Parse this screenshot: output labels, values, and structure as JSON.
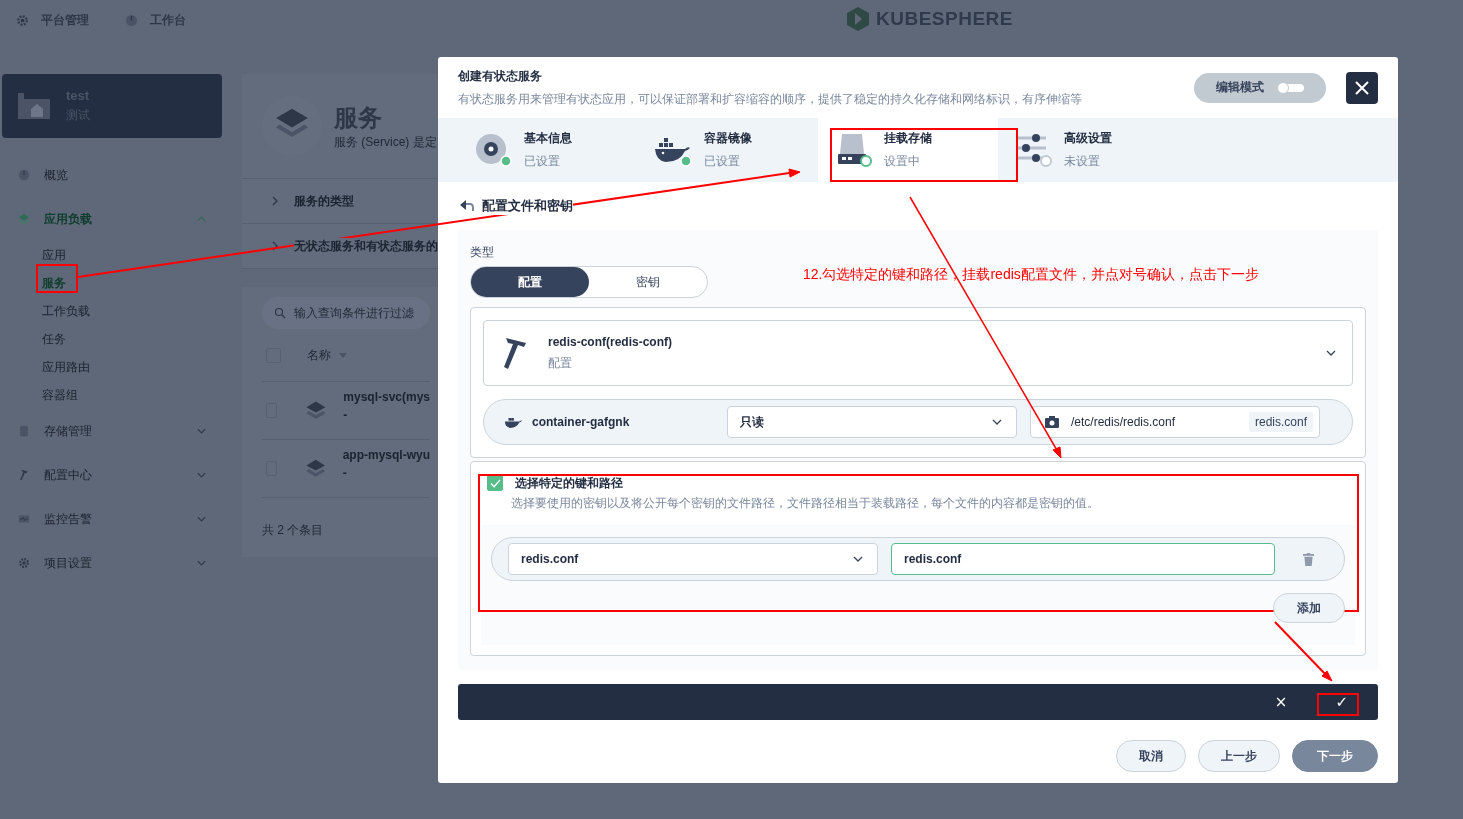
{
  "top_nav": [
    {
      "label": "平台管理"
    },
    {
      "label": "工作台"
    }
  ],
  "logo": {
    "text": "KUBESPHERE"
  },
  "project": {
    "name": "test",
    "alias": "测试"
  },
  "sidebar": {
    "items": [
      {
        "label": "概览",
        "selected": false
      },
      {
        "label": "应用负载",
        "selected": true,
        "expanded": true,
        "children": [
          {
            "label": "应用",
            "selected": false
          },
          {
            "label": "服务",
            "selected": true
          },
          {
            "label": "工作负载",
            "selected": false
          },
          {
            "label": "任务",
            "selected": false
          },
          {
            "label": "应用路由",
            "selected": false
          },
          {
            "label": "容器组",
            "selected": false
          }
        ]
      },
      {
        "label": "存储管理",
        "selected": false,
        "expanded": false
      },
      {
        "label": "配置中心",
        "selected": false,
        "expanded": false
      },
      {
        "label": "监控告警",
        "selected": false,
        "expanded": false
      },
      {
        "label": "项目设置",
        "selected": false,
        "expanded": false
      }
    ]
  },
  "page": {
    "title": "服务",
    "description": "服务 (Service) 是定",
    "sections": [
      "服务的类型",
      "无状态服务和有状态服务的"
    ],
    "search": {
      "placeholder": "输入查询条件进行过滤"
    },
    "table": {
      "select_all": {
        "checked": false
      },
      "columns": [
        "名称"
      ],
      "rows": [
        {
          "name": "mysql-svc(mys",
          "sub": "-",
          "checked": false
        },
        {
          "name": "app-mysql-wyu",
          "sub": "-",
          "checked": false
        }
      ]
    },
    "total": "共 2 个条目"
  },
  "modal": {
    "title": "创建有状态服务",
    "description": "有状态服务用来管理有状态应用，可以保证部署和扩容缩容的顺序，提供了稳定的持久化存储和网络标识，有序伸缩等",
    "edit_mode": {
      "label": "编辑模式",
      "on": false
    },
    "steps": [
      {
        "title": "基本信息",
        "status": "已设置",
        "completed": true,
        "selected": false
      },
      {
        "title": "容器镜像",
        "status": "已设置",
        "completed": true,
        "selected": false
      },
      {
        "title": "挂载存储",
        "status": "设置中",
        "completed": false,
        "selected": true
      },
      {
        "title": "高级设置",
        "status": "未设置",
        "completed": false,
        "selected": false
      }
    ],
    "back_label": "配置文件和密钥",
    "type_label": "类型",
    "type_tabs": [
      {
        "label": "配置",
        "selected": true
      },
      {
        "label": "密钥",
        "selected": false
      }
    ],
    "resource": {
      "name": "redis-conf(redis-conf)",
      "type": "配置"
    },
    "mount": {
      "container": "container-gafgnk",
      "mode": "只读",
      "path": "/etc/redis/redis.conf",
      "tag": "redis.conf"
    },
    "specific_keys": {
      "label": "选择特定的键和路径",
      "checked": true,
      "description": "选择要使用的密钥以及将公开每个密钥的文件路径，文件路径相当于装载路径，每个文件的内容都是密钥的值。",
      "items": [
        {
          "key": "redis.conf",
          "path": "redis.conf"
        }
      ],
      "add_label": "添加"
    },
    "confirm_bar": {
      "cancel": "×",
      "confirm": "✓"
    },
    "buttons": [
      {
        "label": "取消",
        "kind": "default"
      },
      {
        "label": "上一步",
        "kind": "default"
      },
      {
        "label": "下一步",
        "kind": "primary"
      }
    ]
  },
  "annotation": {
    "text": "12.勾选特定的键和路径，挂载redis配置文件，并点对号确认，点击下一步"
  }
}
